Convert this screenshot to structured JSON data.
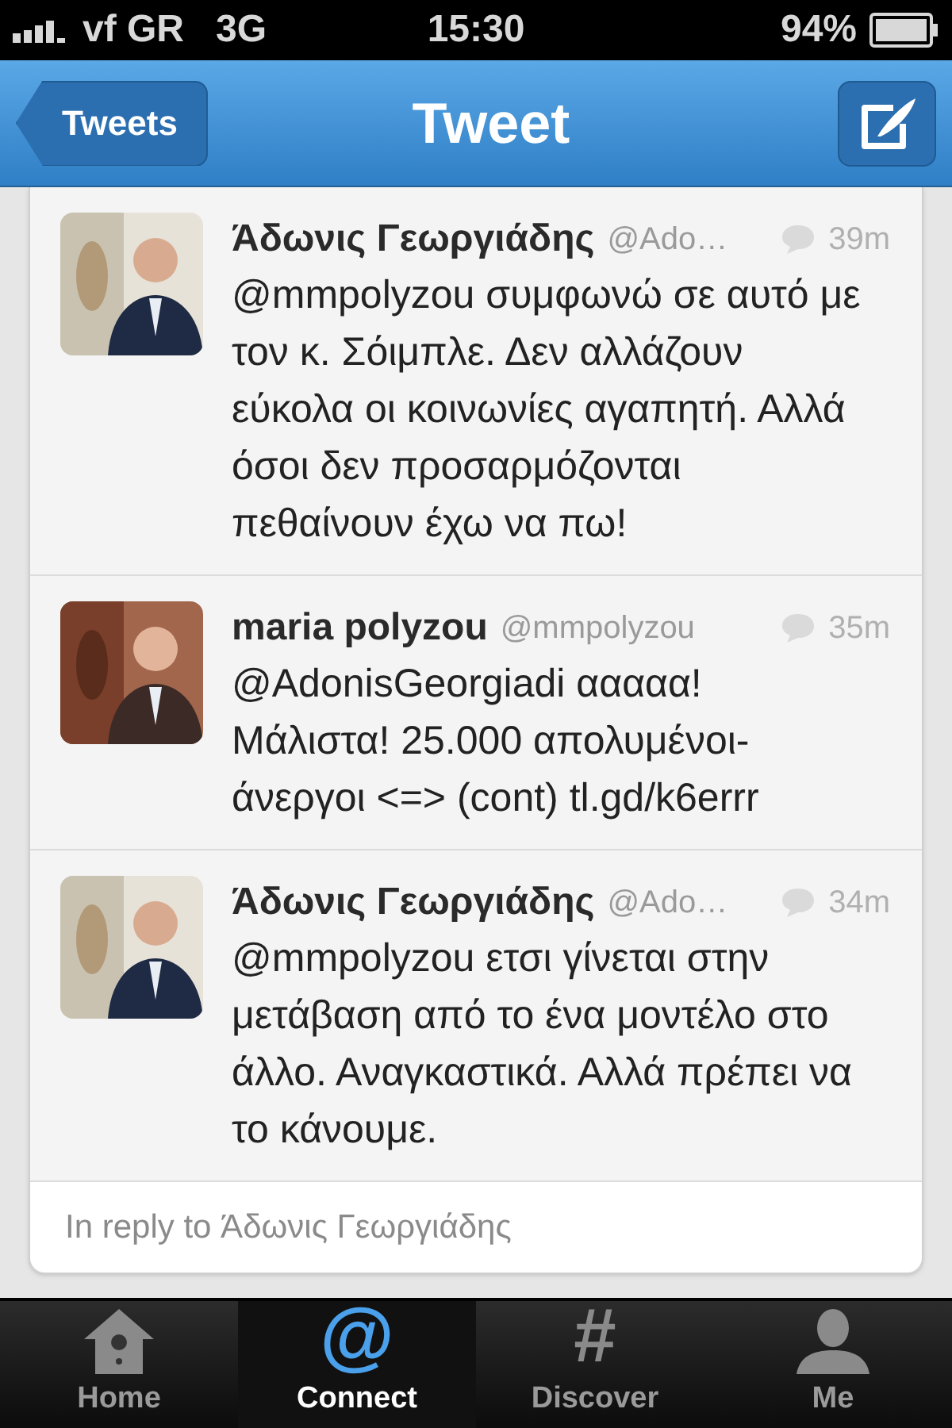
{
  "status_bar": {
    "carrier": "vf GR",
    "network": "3G",
    "time": "15:30",
    "battery": "94%"
  },
  "nav_bar": {
    "back": "Tweets",
    "title": "Tweet"
  },
  "tweets": [
    {
      "name": "Άδωνις Γεωργιάδης",
      "handle": "@Ado…",
      "time": "39m",
      "text": "@mmpolyzou συμφωνώ σε αυτό με\nτον κ. Σόιμπλε. Δεν αλλάζουν\nεύκολα οι κοινωνίες αγαπητή. Αλλά\nόσοι δεν προσαρμόζονται\nπεθαίνουν έχω να πω!"
    },
    {
      "name": "maria polyzou",
      "handle": "@mmpolyzou",
      "time": "35m",
      "text": "@AdonisGeorgiadi ααααα!\nΜάλιστα! 25.000 απολυμένοι-\nάνεργοι <=> (cont) tl.gd/k6errr"
    },
    {
      "name": "Άδωνις Γεωργιάδης",
      "handle": "@Ado…",
      "time": "34m",
      "text": "@mmpolyzou ετσι γίνεται στην\nμετάβαση από το ένα μοντέλο στο\nάλλο. Αναγκαστικά. Αλλά πρέπει να\nτο κάνουμε."
    }
  ],
  "in_reply_to": "In reply to Άδωνις Γεωργιάδης",
  "tab_bar": [
    {
      "label": "Home",
      "kind": "house",
      "selected": false
    },
    {
      "label": "Connect",
      "kind": "glyph",
      "glyph": "@",
      "selected": true
    },
    {
      "label": "Discover",
      "kind": "glyph",
      "glyph": "#",
      "selected": false
    },
    {
      "label": "Me",
      "kind": "person",
      "selected": false
    }
  ]
}
